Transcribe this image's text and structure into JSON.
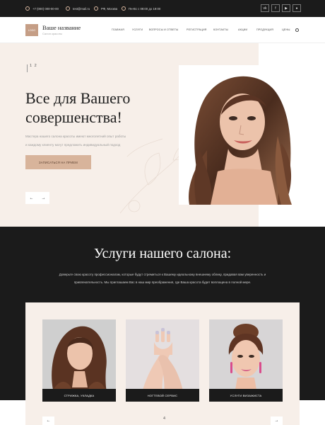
{
  "topbar": {
    "phone": "+7 (000) 000-00-00",
    "email": "test@mail.ru",
    "city": "РФ, Москва",
    "hours": "Пн-Вс с 08:00 до 19:00",
    "socials": [
      "vk-icon",
      "fb-icon",
      "yt-icon",
      "ok-icon"
    ]
  },
  "header": {
    "logo_text": "LOGO",
    "brand": "Ваше название",
    "brand_sub": "Салон красоты",
    "nav": [
      "ГЛАВНАЯ",
      "УСЛУГИ",
      "ВОПРОСЫ И ОТВЕТЫ",
      "РЕГИСТРАЦИЯ",
      "КОНТАКТЫ",
      "АКЦИИ",
      "ПРОДУКЦИЯ",
      "ЦЕНЫ"
    ]
  },
  "hero": {
    "slide_current": "1",
    "slide_next": "2",
    "title_line1": "Все для Вашего",
    "title_line2": "совершенства!",
    "text_line1": "Мастера нашего салона красоты имеют многолетний опыт работы",
    "text_line2": "и каждому клиенту могут предложить индивидуальный подход",
    "button": "ЗАПИСАТЬСЯ НА ПРИЕМ",
    "prev": "←",
    "next": "→"
  },
  "services": {
    "title": "Услуги нашего салона:",
    "text_line1": "Доверьте свою красоту профессионалам, которые будут стремиться к Вашему идеальному внешнему облику, придавая вам уверенность и",
    "text_line2": "привлекательность. Мы приглашаем Вас в наш мир преображения, где Ваша красота будет воплощена в полной мере.",
    "cards": [
      {
        "label": "СТРИЖКА, УКЛАДКА"
      },
      {
        "label": "НОГТЕВОЙ СЕРВИС"
      },
      {
        "label": "УСЛУГИ ВИЗАЖИСТА"
      }
    ],
    "page_num": "4",
    "prev": "←",
    "next": "→"
  },
  "colors": {
    "dark": "#1b1b1b",
    "cream": "#f7efe9",
    "accent": "#d8b49b"
  }
}
